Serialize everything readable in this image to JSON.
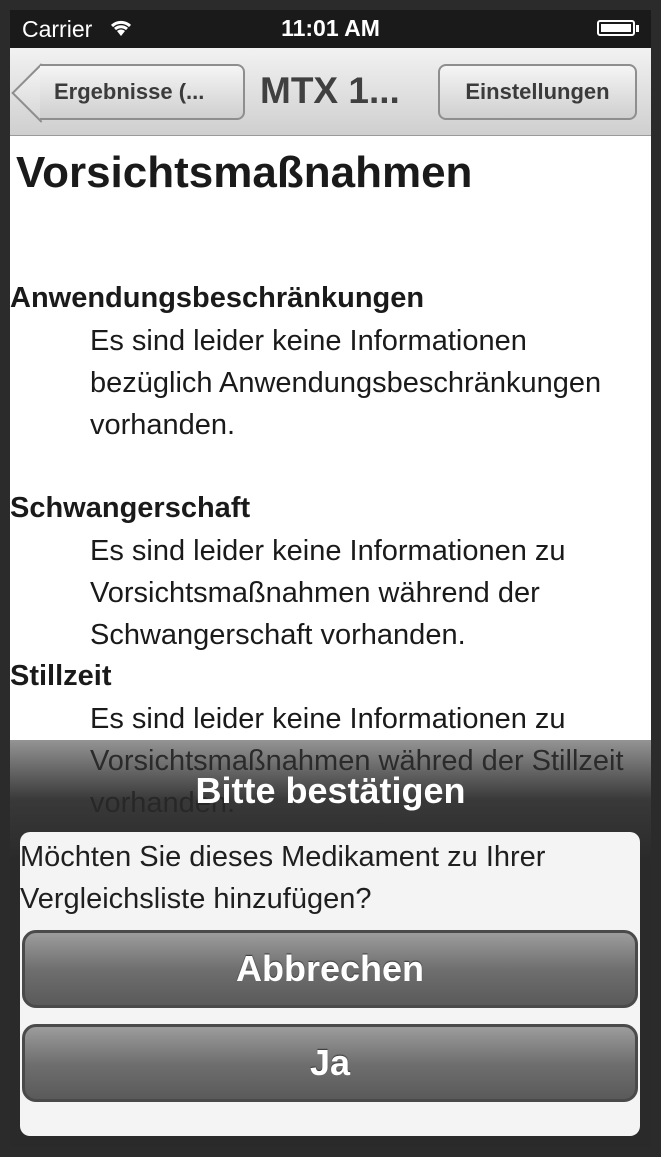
{
  "status_bar": {
    "carrier": "Carrier",
    "time": "11:01 AM"
  },
  "nav_bar": {
    "back_label": "Ergebnisse (...",
    "title": "MTX 1...",
    "settings_label": "Einstellungen"
  },
  "page": {
    "title": "Vorsichtsmaßnahmen",
    "sections": [
      {
        "heading": "Anwendungsbeschränkungen",
        "body": "Es sind leider keine Informationen bezüglich Anwendungsbeschränkungen vorhanden."
      },
      {
        "heading": "Schwangerschaft",
        "body": "Es sind leider keine Informationen zu Vorsichtsmaßnahmen während der Schwangerschaft vorhanden."
      },
      {
        "heading": "Stillzeit",
        "body": "Es sind leider keine Informationen zu Vorsichtsmaßnahmen währed der Stillzeit vorhanden."
      }
    ]
  },
  "action_sheet": {
    "title": "Bitte bestätigen",
    "message": "Möchten Sie dieses Medikament zu Ihrer Vergleichsliste hinzufügen?",
    "cancel_label": "Abbrechen",
    "confirm_label": "Ja"
  }
}
